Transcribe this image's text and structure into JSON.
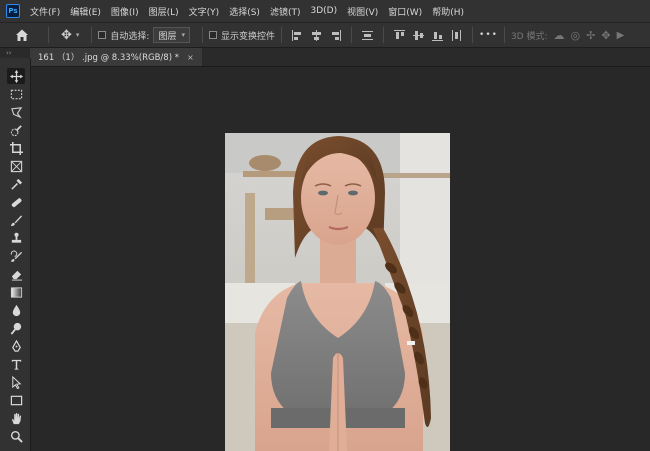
{
  "app": {
    "logo_text": "Ps"
  },
  "menu": [
    "文件(F)",
    "编辑(E)",
    "图像(I)",
    "图层(L)",
    "文字(Y)",
    "选择(S)",
    "滤镜(T)",
    "3D(D)",
    "视图(V)",
    "窗口(W)",
    "帮助(H)"
  ],
  "options": {
    "auto_select_label": "自动选择:",
    "auto_select_value": "图层",
    "show_transform_label": "显示变换控件",
    "more_label": "•••",
    "mode_3d_label": "3D 模式:"
  },
  "toolbar": {
    "collapse_label": "››"
  },
  "document": {
    "tab_title": "161 （1） .jpg @ 8.33%(RGB/8) *",
    "close_label": "×"
  },
  "icons": [
    "home-icon",
    "move-icon",
    "marquee-icon",
    "lasso-icon",
    "quick-select-icon",
    "crop-icon",
    "frame-icon",
    "eyedropper-icon",
    "healing-brush-icon",
    "brush-icon",
    "clone-stamp-icon",
    "history-brush-icon",
    "eraser-icon",
    "gradient-icon",
    "blur-icon",
    "dodge-icon",
    "pen-icon",
    "type-icon",
    "path-select-icon",
    "rectangle-icon",
    "hand-icon",
    "zoom-icon"
  ],
  "colors": {
    "panel": "#323232",
    "canvas_bg": "#282828",
    "accent": "#31a8ff"
  }
}
